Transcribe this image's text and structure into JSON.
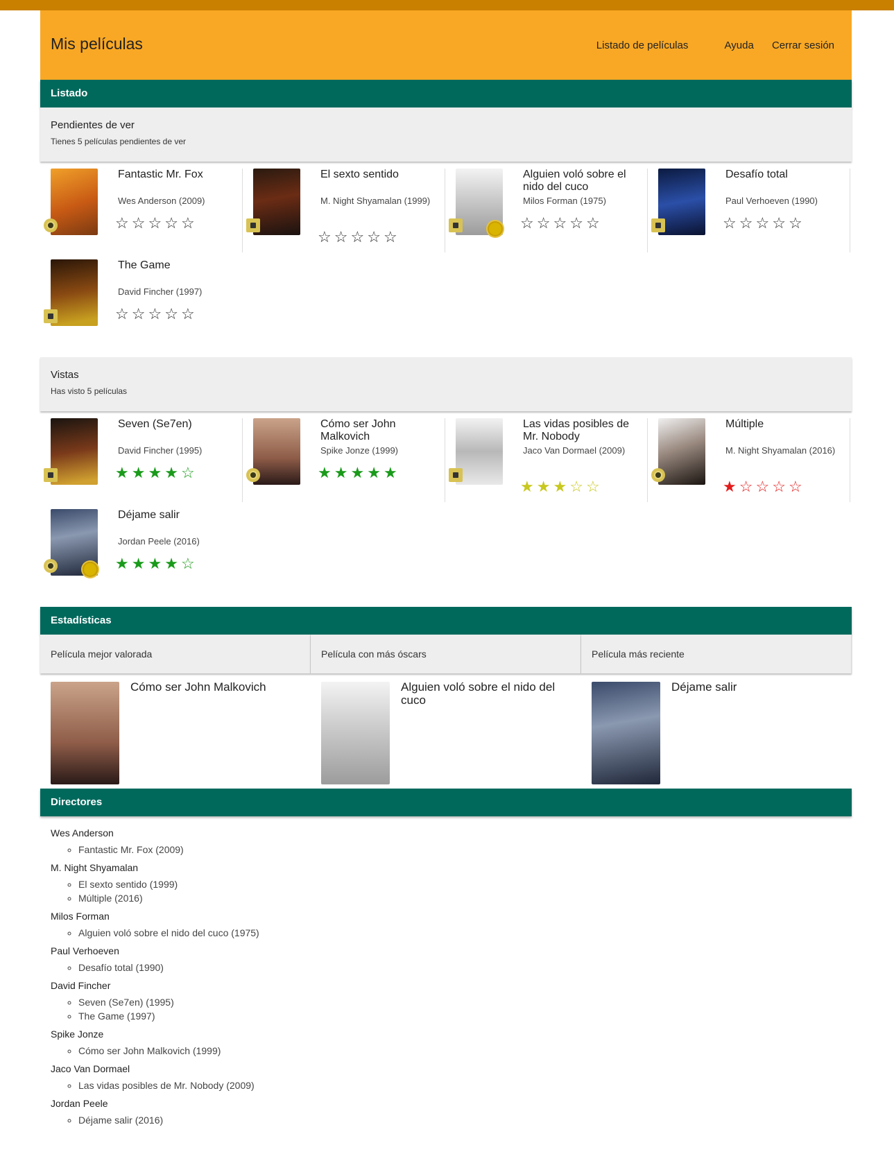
{
  "header": {
    "brand": "Mis películas",
    "nav": [
      "Listado de películas",
      "Ayuda",
      "Cerrar sesión"
    ]
  },
  "sections": {
    "listado": "Listado",
    "estadisticas": "Estadísticas",
    "directores": "Directores"
  },
  "pendientes": {
    "title": "Pendientes de ver",
    "subtitle": "Tienes 5 películas pendientes de ver",
    "movies": [
      {
        "title": "Fantastic Mr. Fox",
        "director": "Wes Anderson (2009)",
        "rating": 0,
        "icon": "disc-icon"
      },
      {
        "title": "El sexto sentido",
        "director": "M. Night Shyamalan (1999)",
        "rating": 0,
        "icon": "file-icon"
      },
      {
        "title": "Alguien voló sobre el nido del cuco",
        "director": "Milos Forman (1975)",
        "rating": 0,
        "icon": "vhs-icon",
        "oscar": true
      },
      {
        "title": "Desafío total",
        "director": "Paul Verhoeven (1990)",
        "rating": 0,
        "icon": "vhs-icon"
      },
      {
        "title": "The Game",
        "director": "David Fincher (1997)",
        "rating": 0,
        "icon": "file-icon"
      }
    ]
  },
  "vistas": {
    "title": "Vistas",
    "subtitle": "Has visto 5 películas",
    "movies": [
      {
        "title": "Seven (Se7en)",
        "director": "David Fincher (1995)",
        "rating": 4,
        "color": "#1a9a1a",
        "icon": "file-icon"
      },
      {
        "title": "Cómo ser John Malkovich",
        "director": "Spike Jonze (1999)",
        "rating": 5,
        "color": "#1a9a1a",
        "icon": "disc-icon"
      },
      {
        "title": "Las vidas posibles de Mr. Nobody",
        "director": "Jaco Van Dormael (2009)",
        "rating": 3,
        "color": "#c8c81e",
        "icon": "file-icon"
      },
      {
        "title": "Múltiple",
        "director": "M. Night Shyamalan (2016)",
        "rating": 1,
        "color": "#e31b1b",
        "icon": "disc-icon"
      },
      {
        "title": "Déjame salir",
        "director": "Jordan Peele (2016)",
        "rating": 4,
        "color": "#1a9a1a",
        "icon": "disc-icon",
        "oscar": true
      }
    ]
  },
  "stats": [
    {
      "label": "Película mejor valorada",
      "movie": "Cómo ser John Malkovich"
    },
    {
      "label": "Película con más óscars",
      "movie": "Alguien voló sobre el nido del cuco"
    },
    {
      "label": "Película más reciente",
      "movie": "Déjame salir"
    }
  ],
  "directors": [
    {
      "name": "Wes Anderson",
      "films": [
        "Fantastic Mr. Fox (2009)"
      ]
    },
    {
      "name": "M. Night Shyamalan",
      "films": [
        "El sexto sentido (1999)",
        "Múltiple (2016)"
      ]
    },
    {
      "name": "Milos Forman",
      "films": [
        "Alguien voló sobre el nido del cuco (1975)"
      ]
    },
    {
      "name": "Paul Verhoeven",
      "films": [
        "Desafío total (1990)"
      ]
    },
    {
      "name": "David Fincher",
      "films": [
        "Seven (Se7en) (1995)",
        "The Game (1997)"
      ]
    },
    {
      "name": "Spike Jonze",
      "films": [
        "Cómo ser John Malkovich (1999)"
      ]
    },
    {
      "name": "Jaco Van Dormael",
      "films": [
        "Las vidas posibles de Mr. Nobody (2009)"
      ]
    },
    {
      "name": "Jordan Peele",
      "films": [
        "Déjame salir (2016)"
      ]
    }
  ]
}
